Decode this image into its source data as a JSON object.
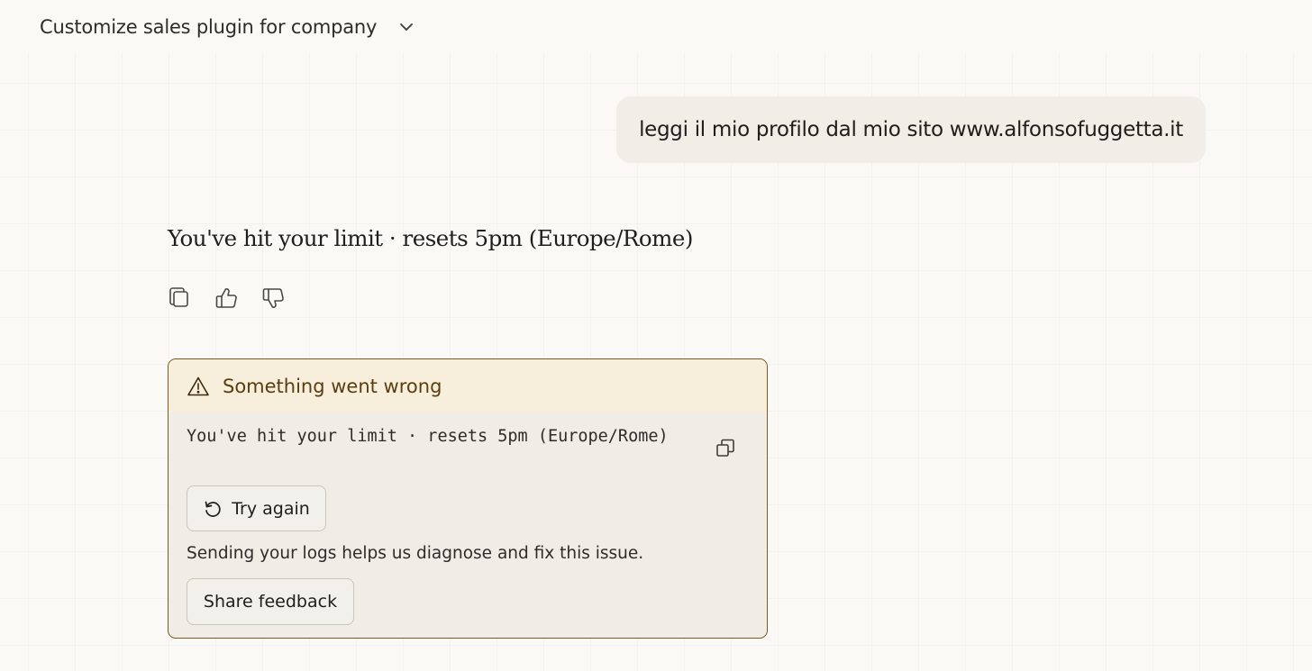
{
  "header": {
    "title": "Customize sales plugin for company",
    "dropdown_icon": "chevron-down-icon"
  },
  "conversation": {
    "user_message": "leggi il mio profilo dal mio sito www.alfonsofuggetta.it",
    "assistant_message": "You've hit your limit · resets 5pm (Europe/Rome)",
    "actions": {
      "copy_icon": "copy-icon",
      "thumbs_up_icon": "thumbs-up-icon",
      "thumbs_down_icon": "thumbs-down-icon"
    }
  },
  "error": {
    "title": "Something went wrong",
    "icon": "warning-triangle-icon",
    "code": "You've hit your limit · resets 5pm (Europe/Rome)",
    "retry_label": "Try again",
    "retry_icon": "retry-icon",
    "logs_text": "Sending your logs helps us diagnose and fix this issue.",
    "feedback_label": "Share feedback"
  },
  "colors": {
    "background": "#faf9f5",
    "user_bubble": "#f0eee6",
    "error_border": "#7a5a23",
    "error_header_bg": "#f7efdb",
    "error_title": "#5b3d10",
    "error_body_bg": "#f0ede6"
  }
}
